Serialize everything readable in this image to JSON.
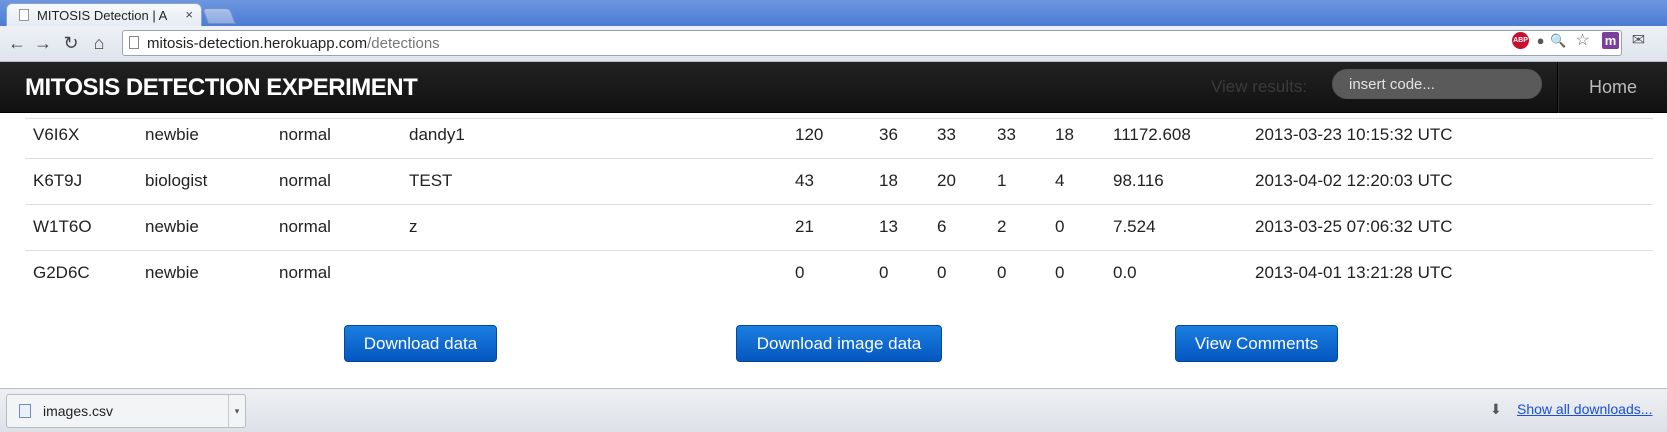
{
  "browser": {
    "tab_title": "MITOSIS Detection | A",
    "tab_close": "×",
    "url_host": "mitosis-detection.herokuapp.com",
    "url_path": "/detections",
    "nav": {
      "back": "←",
      "forward": "→",
      "reload": "↻",
      "home": "⌂"
    },
    "extensions": {
      "abp": "ABP",
      "bulb": "●",
      "zoom": "🔍",
      "star": "☆",
      "mexchange": "m",
      "mail": "✉"
    }
  },
  "app": {
    "brand": "MITOSIS DETECTION EXPERIMENT",
    "view_results_label": "View results:",
    "code_placeholder": "insert code...",
    "home_link": "Home"
  },
  "table": {
    "rows": [
      [
        "V6I6X",
        "newbie",
        "normal",
        "dandy1",
        "120",
        "36",
        "33",
        "33",
        "18",
        "11172.608",
        "2013-03-23 10:15:32 UTC"
      ],
      [
        "K6T9J",
        "biologist",
        "normal",
        "TEST",
        "43",
        "18",
        "20",
        "1",
        "4",
        "98.116",
        "2013-04-02 12:20:03 UTC"
      ],
      [
        "W1T6O",
        "newbie",
        "normal",
        "z",
        "21",
        "13",
        "6",
        "2",
        "0",
        "7.524",
        "2013-03-25 07:06:32 UTC"
      ],
      [
        "G2D6C",
        "newbie",
        "normal",
        "",
        "0",
        "0",
        "0",
        "0",
        "0",
        "0.0",
        "2013-04-01 13:21:28 UTC"
      ]
    ]
  },
  "actions": {
    "download_data": "Download data",
    "download_image_data": "Download image data",
    "view_comments": "View Comments"
  },
  "downloads": {
    "file_name": "images.csv",
    "dropdown": "▾",
    "arrow": "⬇",
    "show_all": "Show all downloads..."
  }
}
